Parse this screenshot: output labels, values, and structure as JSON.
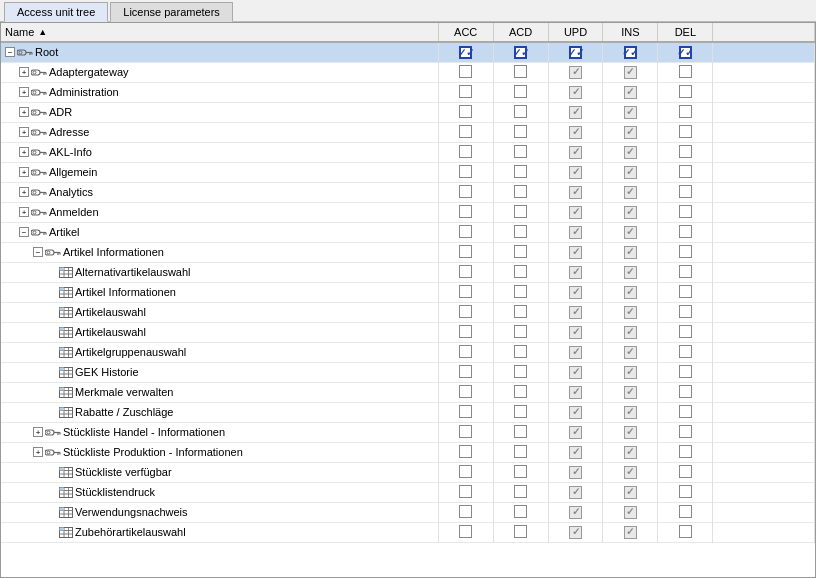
{
  "tabs": [
    {
      "id": "access-unit-tree",
      "label": "Access unit tree",
      "active": true
    },
    {
      "id": "license-parameters",
      "label": "License parameters",
      "active": false
    }
  ],
  "table": {
    "columns": [
      {
        "id": "name",
        "label": "Name",
        "sortable": true
      },
      {
        "id": "acc",
        "label": "ACC"
      },
      {
        "id": "acd",
        "label": "ACD"
      },
      {
        "id": "upd",
        "label": "UPD"
      },
      {
        "id": "ins",
        "label": "INS"
      },
      {
        "id": "del",
        "label": "DEL"
      }
    ],
    "rows": [
      {
        "id": 1,
        "indent": 0,
        "expandable": true,
        "expanded": true,
        "icon": "key",
        "label": "Root",
        "selected": true,
        "acc": "checked",
        "acd": "checked",
        "upd": "checked",
        "ins": "checked",
        "del": "checked"
      },
      {
        "id": 2,
        "indent": 1,
        "expandable": true,
        "expanded": false,
        "icon": "key",
        "label": "Adaptergateway",
        "selected": false,
        "acc": "empty",
        "acd": "empty",
        "upd": "grayed",
        "ins": "grayed",
        "del": "empty"
      },
      {
        "id": 3,
        "indent": 1,
        "expandable": true,
        "expanded": false,
        "icon": "key",
        "label": "Administration",
        "selected": false,
        "acc": "empty",
        "acd": "empty",
        "upd": "grayed",
        "ins": "grayed",
        "del": "empty"
      },
      {
        "id": 4,
        "indent": 1,
        "expandable": true,
        "expanded": false,
        "icon": "key",
        "label": "ADR",
        "selected": false,
        "acc": "empty",
        "acd": "empty",
        "upd": "grayed",
        "ins": "grayed",
        "del": "empty"
      },
      {
        "id": 5,
        "indent": 1,
        "expandable": true,
        "expanded": false,
        "icon": "key",
        "label": "Adresse",
        "selected": false,
        "acc": "empty",
        "acd": "empty",
        "upd": "grayed",
        "ins": "grayed",
        "del": "empty"
      },
      {
        "id": 6,
        "indent": 1,
        "expandable": true,
        "expanded": false,
        "icon": "key",
        "label": "AKL-Info",
        "selected": false,
        "acc": "empty",
        "acd": "empty",
        "upd": "grayed",
        "ins": "grayed",
        "del": "empty"
      },
      {
        "id": 7,
        "indent": 1,
        "expandable": true,
        "expanded": false,
        "icon": "key",
        "label": "Allgemein",
        "selected": false,
        "acc": "empty",
        "acd": "empty",
        "upd": "grayed",
        "ins": "grayed",
        "del": "empty"
      },
      {
        "id": 8,
        "indent": 1,
        "expandable": true,
        "expanded": false,
        "icon": "key",
        "label": "Analytics",
        "selected": false,
        "acc": "empty",
        "acd": "empty",
        "upd": "grayed",
        "ins": "grayed",
        "del": "empty"
      },
      {
        "id": 9,
        "indent": 1,
        "expandable": true,
        "expanded": false,
        "icon": "key",
        "label": "Anmelden",
        "selected": false,
        "acc": "empty",
        "acd": "empty",
        "upd": "grayed",
        "ins": "grayed",
        "del": "empty"
      },
      {
        "id": 10,
        "indent": 1,
        "expandable": true,
        "expanded": true,
        "icon": "key",
        "label": "Artikel",
        "selected": false,
        "acc": "empty",
        "acd": "empty",
        "upd": "grayed",
        "ins": "grayed",
        "del": "empty"
      },
      {
        "id": 11,
        "indent": 2,
        "expandable": true,
        "expanded": true,
        "icon": "key",
        "label": "Artikel Informationen",
        "selected": false,
        "acc": "empty",
        "acd": "empty",
        "upd": "grayed",
        "ins": "grayed",
        "del": "empty"
      },
      {
        "id": 12,
        "indent": 3,
        "expandable": false,
        "expanded": false,
        "icon": "table",
        "label": "Alternativartikelauswahl",
        "selected": false,
        "acc": "empty",
        "acd": "empty",
        "upd": "grayed",
        "ins": "grayed",
        "del": "empty"
      },
      {
        "id": 13,
        "indent": 3,
        "expandable": false,
        "expanded": false,
        "icon": "table",
        "label": "Artikel Informationen",
        "selected": false,
        "acc": "empty",
        "acd": "empty",
        "upd": "grayed",
        "ins": "grayed",
        "del": "empty"
      },
      {
        "id": 14,
        "indent": 3,
        "expandable": false,
        "expanded": false,
        "icon": "table",
        "label": "Artikelauswahl",
        "selected": false,
        "acc": "empty",
        "acd": "empty",
        "upd": "grayed",
        "ins": "grayed",
        "del": "empty"
      },
      {
        "id": 15,
        "indent": 3,
        "expandable": false,
        "expanded": false,
        "icon": "table",
        "label": "Artikelauswahl",
        "selected": false,
        "acc": "empty",
        "acd": "empty",
        "upd": "grayed",
        "ins": "grayed",
        "del": "empty"
      },
      {
        "id": 16,
        "indent": 3,
        "expandable": false,
        "expanded": false,
        "icon": "table",
        "label": "Artikelgruppenauswahl",
        "selected": false,
        "acc": "empty",
        "acd": "empty",
        "upd": "grayed",
        "ins": "grayed",
        "del": "empty"
      },
      {
        "id": 17,
        "indent": 3,
        "expandable": false,
        "expanded": false,
        "icon": "table",
        "label": "GEK Historie",
        "selected": false,
        "acc": "empty",
        "acd": "empty",
        "upd": "grayed",
        "ins": "grayed",
        "del": "empty"
      },
      {
        "id": 18,
        "indent": 3,
        "expandable": false,
        "expanded": false,
        "icon": "table",
        "label": "Merkmale verwalten",
        "selected": false,
        "acc": "empty",
        "acd": "empty",
        "upd": "grayed",
        "ins": "grayed",
        "del": "empty"
      },
      {
        "id": 19,
        "indent": 3,
        "expandable": false,
        "expanded": false,
        "icon": "table",
        "label": "Rabatte / Zuschläge",
        "selected": false,
        "acc": "empty",
        "acd": "empty",
        "upd": "grayed",
        "ins": "grayed",
        "del": "empty"
      },
      {
        "id": 20,
        "indent": 2,
        "expandable": true,
        "expanded": false,
        "icon": "key",
        "label": "Stückliste Handel - Informationen",
        "selected": false,
        "acc": "empty",
        "acd": "empty",
        "upd": "grayed",
        "ins": "grayed",
        "del": "empty"
      },
      {
        "id": 21,
        "indent": 2,
        "expandable": true,
        "expanded": false,
        "icon": "key",
        "label": "Stückliste Produktion - Informationen",
        "selected": false,
        "acc": "empty",
        "acd": "empty",
        "upd": "grayed",
        "ins": "grayed",
        "del": "empty"
      },
      {
        "id": 22,
        "indent": 3,
        "expandable": false,
        "expanded": false,
        "icon": "table",
        "label": "Stückliste verfügbar",
        "selected": false,
        "acc": "empty",
        "acd": "empty",
        "upd": "grayed",
        "ins": "grayed",
        "del": "empty"
      },
      {
        "id": 23,
        "indent": 3,
        "expandable": false,
        "expanded": false,
        "icon": "table",
        "label": "Stücklistendruck",
        "selected": false,
        "acc": "empty",
        "acd": "empty",
        "upd": "grayed",
        "ins": "grayed",
        "del": "empty"
      },
      {
        "id": 24,
        "indent": 3,
        "expandable": false,
        "expanded": false,
        "icon": "table",
        "label": "Verwendungsnachweis",
        "selected": false,
        "acc": "empty",
        "acd": "empty",
        "upd": "grayed",
        "ins": "grayed",
        "del": "empty"
      },
      {
        "id": 25,
        "indent": 3,
        "expandable": false,
        "expanded": false,
        "icon": "table",
        "label": "Zubehörartikelauswahl",
        "selected": false,
        "acc": "empty",
        "acd": "empty",
        "upd": "grayed",
        "ins": "grayed",
        "del": "empty"
      }
    ]
  }
}
